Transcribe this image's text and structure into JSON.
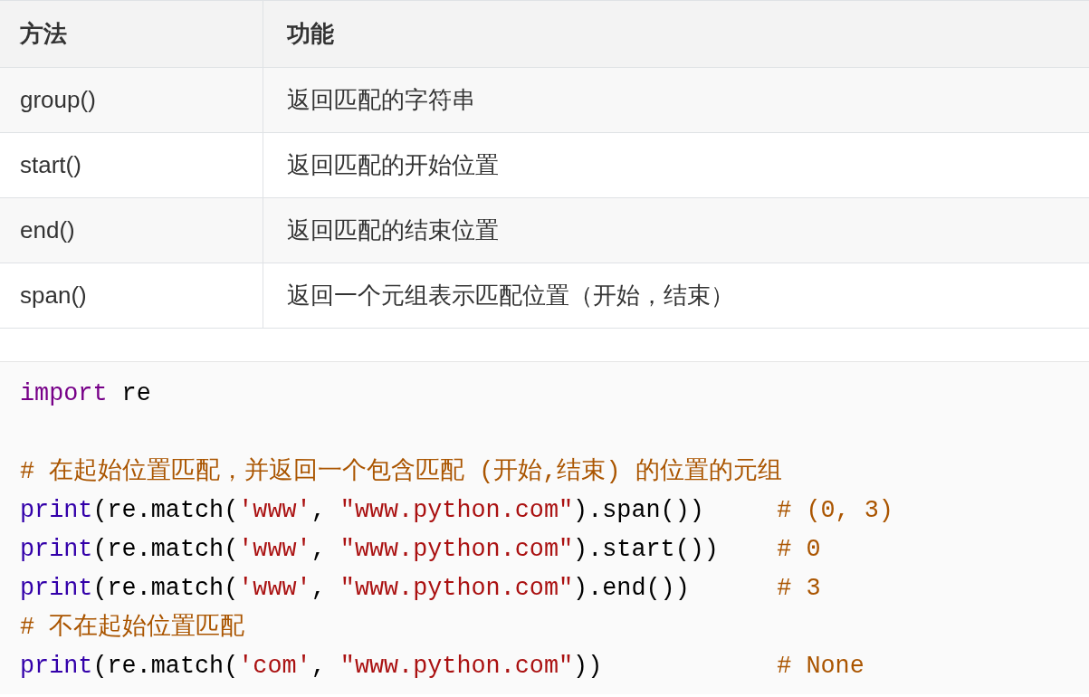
{
  "table": {
    "columns": [
      "方法",
      "功能"
    ],
    "rows": [
      [
        "group()",
        "返回匹配的字符串"
      ],
      [
        "start()",
        "返回匹配的开始位置"
      ],
      [
        "end()",
        "返回匹配的结束位置"
      ],
      [
        "span()",
        "返回一个元组表示匹配位置（开始，结束）"
      ]
    ]
  },
  "code": {
    "lines": [
      [
        {
          "kind": "keyword",
          "text": "import"
        },
        {
          "kind": "plain",
          "text": " re"
        }
      ],
      [
        {
          "kind": "blank"
        }
      ],
      [
        {
          "kind": "comment",
          "text": "# 在起始位置匹配，并返回一个包含匹配 (开始,结束) 的位置的元组"
        }
      ],
      [
        {
          "kind": "builtin",
          "text": "print"
        },
        {
          "kind": "plain",
          "text": "(re.match("
        },
        {
          "kind": "string",
          "text": "'www'"
        },
        {
          "kind": "plain",
          "text": ", "
        },
        {
          "kind": "string",
          "text": "\"www.python.com\""
        },
        {
          "kind": "plain",
          "text": ").span())     "
        },
        {
          "kind": "comment",
          "text": "# (0, 3)"
        }
      ],
      [
        {
          "kind": "builtin",
          "text": "print"
        },
        {
          "kind": "plain",
          "text": "(re.match("
        },
        {
          "kind": "string",
          "text": "'www'"
        },
        {
          "kind": "plain",
          "text": ", "
        },
        {
          "kind": "string",
          "text": "\"www.python.com\""
        },
        {
          "kind": "plain",
          "text": ").start())    "
        },
        {
          "kind": "comment",
          "text": "# 0"
        }
      ],
      [
        {
          "kind": "builtin",
          "text": "print"
        },
        {
          "kind": "plain",
          "text": "(re.match("
        },
        {
          "kind": "string",
          "text": "'www'"
        },
        {
          "kind": "plain",
          "text": ", "
        },
        {
          "kind": "string",
          "text": "\"www.python.com\""
        },
        {
          "kind": "plain",
          "text": ").end())      "
        },
        {
          "kind": "comment",
          "text": "# 3"
        }
      ],
      [
        {
          "kind": "comment",
          "text": "# 不在起始位置匹配"
        }
      ],
      [
        {
          "kind": "builtin",
          "text": "print"
        },
        {
          "kind": "plain",
          "text": "(re.match("
        },
        {
          "kind": "string",
          "text": "'com'"
        },
        {
          "kind": "plain",
          "text": ", "
        },
        {
          "kind": "string",
          "text": "\"www.python.com\""
        },
        {
          "kind": "plain",
          "text": "))            "
        },
        {
          "kind": "comment",
          "text": "# None"
        }
      ]
    ]
  }
}
